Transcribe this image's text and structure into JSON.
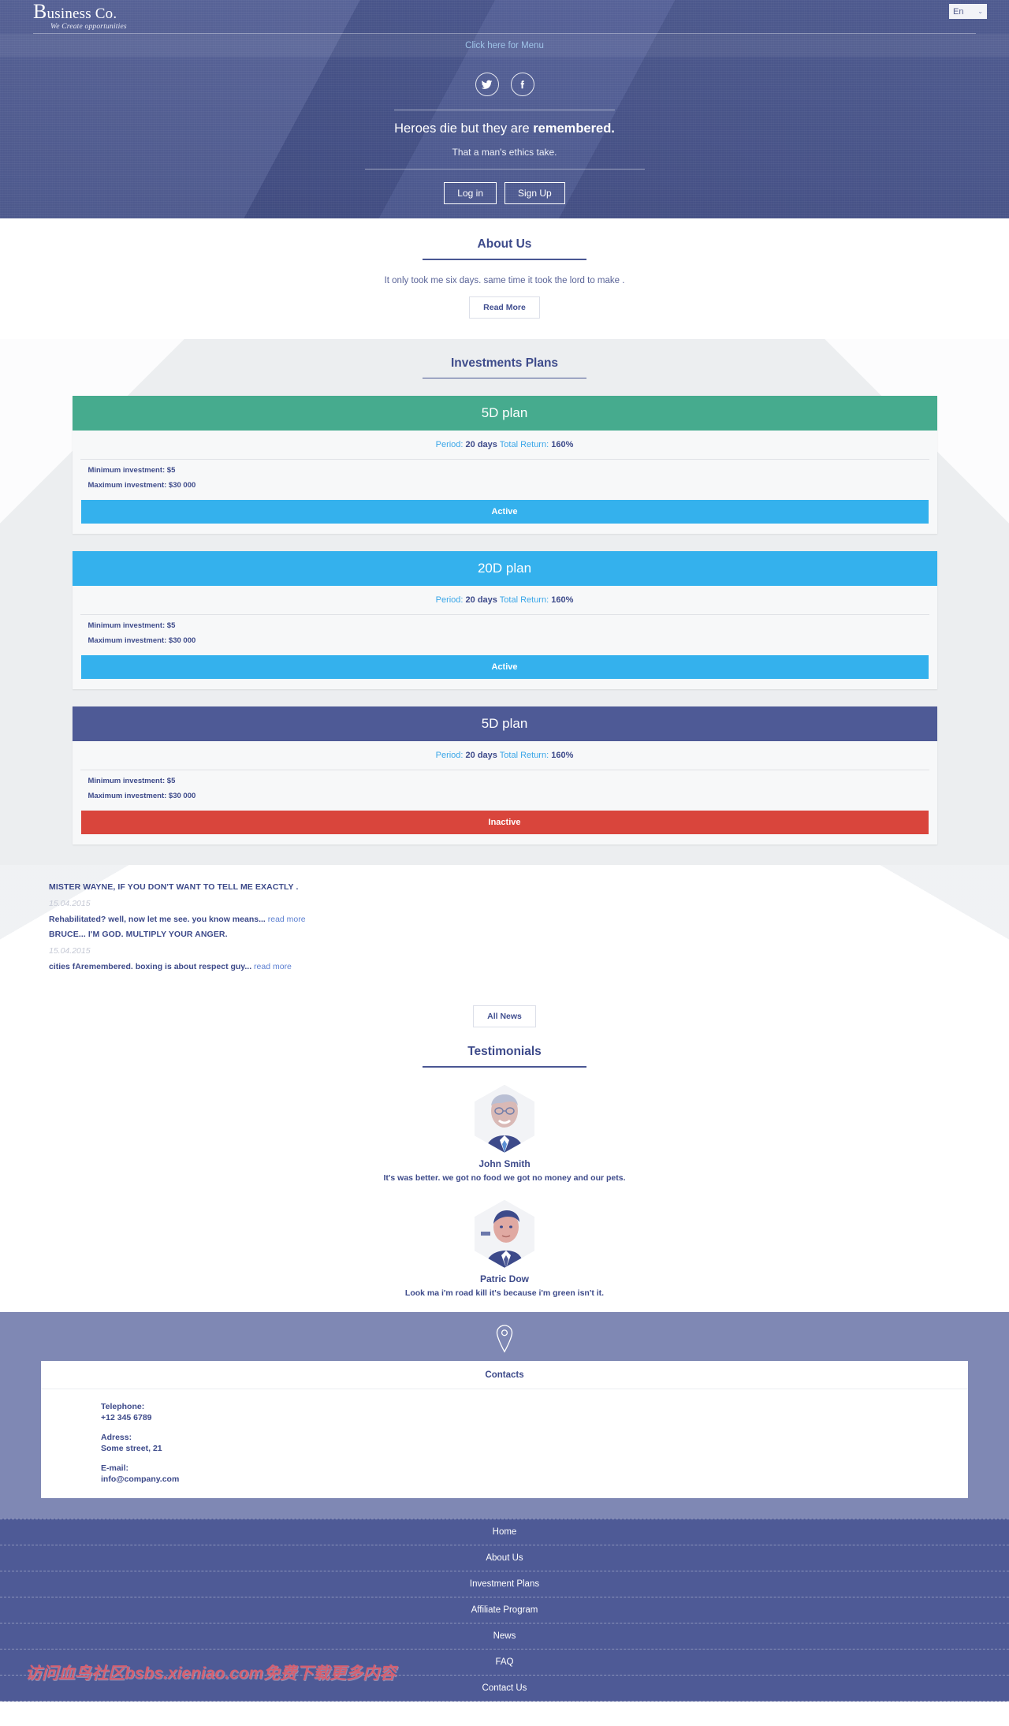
{
  "header": {
    "logo_main": "Business Co.",
    "logo_initial": "B",
    "logo_rest": "usiness Co.",
    "logo_sub": "We Create opportunities",
    "language": "En",
    "language_chevron": "⌄",
    "menu_link": "Click here for Menu"
  },
  "hero": {
    "social": [
      {
        "name": "twitter-icon",
        "label": "Twitter"
      },
      {
        "name": "facebook-icon",
        "label": "Facebook"
      }
    ],
    "title_normal": "Heroes die but they are ",
    "title_bold": "remembered.",
    "subtitle": "That a man's ethics take.",
    "login_label": "Log in",
    "signup_label": "Sign Up"
  },
  "about": {
    "heading": "About Us",
    "text": "It only took me six days. same time it took the lord to make .",
    "read_more": "Read More"
  },
  "plans": {
    "heading": "Investments Plans",
    "period_label": "Period:",
    "return_label": "Total Return:",
    "min_prefix": "Minimum investment: ",
    "max_prefix": "Maximum investment: ",
    "items": [
      {
        "name": "5D plan",
        "header_color": "#46ab8e",
        "period": "20 days",
        "total_return": "160%",
        "min": "$5",
        "max": "$30 000",
        "status": "Active",
        "status_color": "#34b1ed"
      },
      {
        "name": "20D plan",
        "header_color": "#34b1ed",
        "period": "20 days",
        "total_return": "160%",
        "min": "$5",
        "max": "$30 000",
        "status": "Active",
        "status_color": "#34b1ed"
      },
      {
        "name": "5D plan",
        "header_color": "#4e5a96",
        "period": "20 days",
        "total_return": "160%",
        "min": "$5",
        "max": "$30 000",
        "status": "Inactive",
        "status_color": "#d9453c"
      }
    ]
  },
  "news": {
    "all_news_label": "All News",
    "read_more_label": "read more",
    "items": [
      {
        "title": "MISTER WAYNE, IF YOU DON'T WANT TO TELL ME EXACTLY .",
        "date": "15.04.2015",
        "excerpt": "Rehabilitated? well, now let me see. you know means..."
      },
      {
        "title": "BRUCE... I'M GOD. MULTIPLY YOUR ANGER.",
        "date": "15.04.2015",
        "excerpt": "cities fAremembered. boxing is about respect guy..."
      }
    ]
  },
  "testimonials": {
    "heading": "Testimonials",
    "items": [
      {
        "name": "John Smith",
        "text": "It's was better. we got no food we got no money and our pets.",
        "avatar": "avatar-john-smith"
      },
      {
        "name": "Patric Dow",
        "text": "Look ma i'm road kill it's because i'm green isn't it.",
        "avatar": "avatar-patric-dow"
      }
    ]
  },
  "contacts": {
    "heading": "Contacts",
    "telephone_label": "Telephone:",
    "telephone_value": "+12 345 6789",
    "address_label": "Adress:",
    "address_value": "Some street, 21",
    "email_label": "E-mail:",
    "email_value": "info@company.com"
  },
  "footer": {
    "items": [
      "Home",
      "About Us",
      "Investment Plans",
      "Affiliate Program",
      "News",
      "FAQ",
      "Contact Us"
    ],
    "watermark": "访问血鸟社区bsbs.xieniao.com免费下载更多内容"
  },
  "colors": {
    "brand_blue": "#4e5a96",
    "accent_cyan": "#34b1ed",
    "accent_green": "#46ab8e",
    "accent_red": "#d9453c",
    "contacts_bg": "#7f88b4"
  }
}
